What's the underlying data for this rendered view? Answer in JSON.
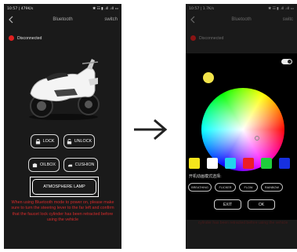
{
  "left_screen": {
    "status_time": "10:57 | 479K/s",
    "status_right": "✱ ☷ ▮ .ıll .ıll ▭",
    "title": "Bluetooth",
    "switch_label": "switch",
    "connection_status": "Disconnected",
    "buttons": {
      "lock": "LOCK",
      "unlock": "UNLOCK",
      "oilbox": "OILBOX",
      "cushion": "CUSHION",
      "atmosphere_lamp": "ATMOSPHERE LAMP"
    },
    "warning": "When using Bluetooth mode to power on, please make sure to turn the steering lever to the far left and confirm that the faucet lock cylinder has been retracted before using the vehicle"
  },
  "right_screen": {
    "status_time": "10:57 | 1.7K/s",
    "status_right": "✱ ☷ ▮ .ıll .ıll ▭",
    "title": "Bluetooth",
    "switch_label": "switc",
    "connection_status": "Disconnected",
    "selected_color": "#f2e44a",
    "swatch_colors": [
      "#f5e51c",
      "#ffffff",
      "#22d3ee",
      "#ee1c25",
      "#1fce3c",
      "#1730e0"
    ],
    "mode_label": "开机动画模式选择:",
    "modes": [
      "BREATHING",
      "FLICKER",
      "FLOW",
      "RAINBOW"
    ],
    "exit_label": "EXIT",
    "ok_label": "OK",
    "warning_dim": "cylinder has been retracted before using the vehicle"
  },
  "colors": {
    "accent_red": "#e02020",
    "warning_red": "#d92b2b",
    "phone_bg": "#1a1a1a"
  }
}
